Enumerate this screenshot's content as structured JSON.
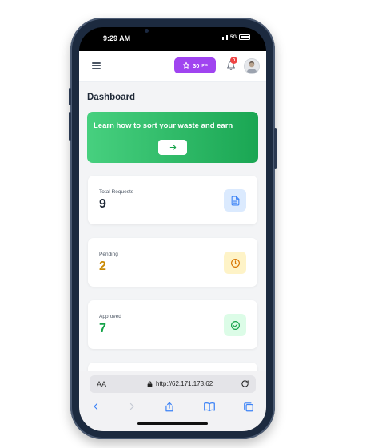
{
  "status_bar": {
    "time": "9:29 AM",
    "network": "5G"
  },
  "header": {
    "points_value": "30",
    "points_unit": "pts",
    "notification_count": "0"
  },
  "page_title": "Dashboard",
  "banner": {
    "text": "Learn how to sort your waste and earn"
  },
  "stats": [
    {
      "label": "Total Requests",
      "value": "9",
      "color": "#1f2937",
      "icon": "document-icon",
      "icon_bg": "#dbeafe",
      "icon_color": "#3b82f6"
    },
    {
      "label": "Pending",
      "value": "2",
      "color": "#ca8a04",
      "icon": "clock-icon",
      "icon_bg": "#fef3c7",
      "icon_color": "#d97706"
    },
    {
      "label": "Approved",
      "value": "7",
      "color": "#16a34a",
      "icon": "check-circle-icon",
      "icon_bg": "#dcfce7",
      "icon_color": "#16a34a"
    }
  ],
  "browser": {
    "text_size_label": "AA",
    "url": "http://62.171.173.62"
  },
  "colors": {
    "accent_purple": "#a044f0",
    "banner_green": "#22c55e"
  }
}
